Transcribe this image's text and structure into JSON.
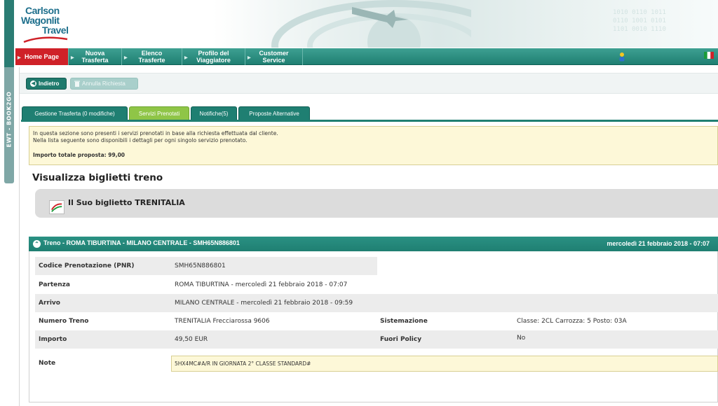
{
  "logo": {
    "line1": "Carlson",
    "line2": "Wagonlit",
    "line3": "Travel"
  },
  "rail": {
    "label": "EWT - BOOK2GO"
  },
  "nav": {
    "items": [
      {
        "label": "Home Page"
      },
      {
        "label1": "Nuova",
        "label2": "Trasferta"
      },
      {
        "label1": "Elenco",
        "label2": "Trasferte"
      },
      {
        "label1": "Profilo del",
        "label2": "Viaggiatore"
      },
      {
        "label1": "Customer",
        "label2": "Service"
      }
    ]
  },
  "actions": {
    "back": "Indietro",
    "cancel": "Annulla Richiesta"
  },
  "tabs": [
    {
      "label": "Gestione Trasferta (0 modifiche)"
    },
    {
      "label": "Servizi Prenotati"
    },
    {
      "label": "Notifiche(5)"
    },
    {
      "label": "Proposte Alternative"
    }
  ],
  "info": {
    "line1": "In questa sezione sono presenti i servizi prenotati in base alla richiesta effettuata dal cliente.",
    "line2": "Nella lista seguente sono disponibili i dettagli per ogni singolo servizio prenotato.",
    "total": "Importo totale proposta: 99,00"
  },
  "page_title": "Visualizza biglietti treno",
  "ticket_title": "Il Suo biglietto TRENITALIA",
  "train": {
    "header": "Treno - ROMA TIBURTINA - MILANO CENTRALE - SMH65N886801",
    "date": "mercoledì 21 febbraio 2018 - 07:07",
    "pnr_label": "Codice Prenotazione (PNR)",
    "pnr": "SMH65N886801",
    "departure_label": "Partenza",
    "departure": "ROMA TIBURTINA - mercoledì 21 febbraio 2018 - 07:07",
    "arrival_label": "Arrivo",
    "arrival": "MILANO CENTRALE - mercoledì 21 febbraio 2018 - 09:59",
    "number_label": "Numero Treno",
    "number": "TRENITALIA Frecciarossa 9606",
    "seat_label": "Sistemazione",
    "seat": "Classe: 2CL  Carrozza: 5  Posto: 03A",
    "amount_label": "Importo",
    "amount": "49,50 EUR",
    "policy_label": "Fuori Policy",
    "policy": "No",
    "notes_label": "Note",
    "notes": "5HX4MC#A/R IN GIORNATA 2° CLASSE STANDARD#"
  },
  "colors": {
    "brand": "#1f7f72",
    "home": "#cf2128",
    "active_tab": "#8fc547",
    "note_bg": "#fdf8d8"
  }
}
